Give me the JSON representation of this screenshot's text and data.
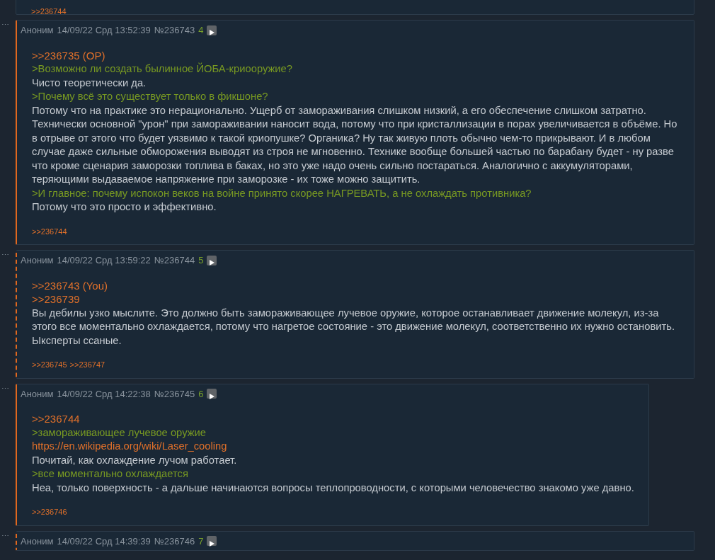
{
  "posts": [
    {
      "highlighted": false,
      "replies": [
        ">>236744"
      ]
    },
    {
      "menu": "⋯",
      "highlighted": true,
      "dashed": false,
      "author": "Аноним",
      "date": "14/09/22 Срд 13:52:39",
      "number": "№236743",
      "index": "4",
      "lines": [
        {
          "kind": "reply",
          "text": ">>236735 (OP)"
        },
        {
          "kind": "quote",
          "text": ">Возможно ли создать былинное ЙОБА-криооружие?"
        },
        {
          "kind": "text",
          "text": "Чисто теоретически да."
        },
        {
          "kind": "quote",
          "text": ">Почему всё это существует только в фикшоне?"
        },
        {
          "kind": "text",
          "text": "Потому что на практике это нерационально. Ущерб от замораживания слишком низкий, а его обеспечение слишком затратно. Технически основной \"урон\" при замораживании наносит вода, потому что при кристаллизации в порах увеличивается в объёме. Но в отрыве от этого что будет уязвимо к такой криопушке? Органика? Ну так живую плоть обычно чем-то прикрывают. И в любом случае даже сильные обморожения выводят из строя не мгновенно. Технике вообще большей частью по барабану будет - ну разве что кроме сценария заморозки топлива в баках, но это уже надо очень сильно постараться. Аналогично с аккумуляторами, теряющими выдаваемое напряжение при заморозке - их тоже можно защитить."
        },
        {
          "kind": "quote",
          "text": ">И главное: почему испокон веков на войне принято скорее НАГРЕВАТЬ, а не охлаждать противника?"
        },
        {
          "kind": "text",
          "text": "Потому что это просто и эффективно."
        }
      ],
      "replies": [
        ">>236744"
      ]
    },
    {
      "menu": "⋯",
      "highlighted": true,
      "dashed": true,
      "author": "Аноним",
      "date": "14/09/22 Срд 13:59:22",
      "number": "№236744",
      "index": "5",
      "lines": [
        {
          "kind": "reply",
          "text": ">>236743 (You)"
        },
        {
          "kind": "reply",
          "text": ">>236739"
        },
        {
          "kind": "text",
          "text": "Вы дебилы узко мыслите. Это должно быть замораживающее лучевое оружие, которое останавливает движение молекул, из-за этого все моментально охлаждается, потому что нагретое состояние - это движение молекул, соответственно их нужно остановить. Ыксперты ссаные."
        }
      ],
      "replies": [
        ">>236745",
        ">>236747"
      ]
    },
    {
      "menu": "⋯",
      "highlighted": true,
      "dashed": false,
      "author": "Аноним",
      "date": "14/09/22 Срд 14:22:38",
      "number": "№236745",
      "index": "6",
      "lines": [
        {
          "kind": "reply",
          "text": ">>236744"
        },
        {
          "kind": "quote",
          "text": ">замораживающее лучевое оружие"
        },
        {
          "kind": "link",
          "text": "https://en.wikipedia.org/wiki/Laser_cooling"
        },
        {
          "kind": "text",
          "text": "Почитай, как охлаждение лучом работает."
        },
        {
          "kind": "quote",
          "text": ">все моментально охлаждается"
        },
        {
          "kind": "text",
          "text": "Неа, только поверхность - а дальше начинаются вопросы теплопроводности, с которыми человечество знакомо уже давно."
        }
      ],
      "replies": [
        ">>236746"
      ]
    },
    {
      "menu": "⋯",
      "highlighted": true,
      "dashed": true,
      "author": "Аноним",
      "date": "14/09/22 Срд 14:39:39",
      "number": "№236746",
      "index": "7"
    }
  ]
}
